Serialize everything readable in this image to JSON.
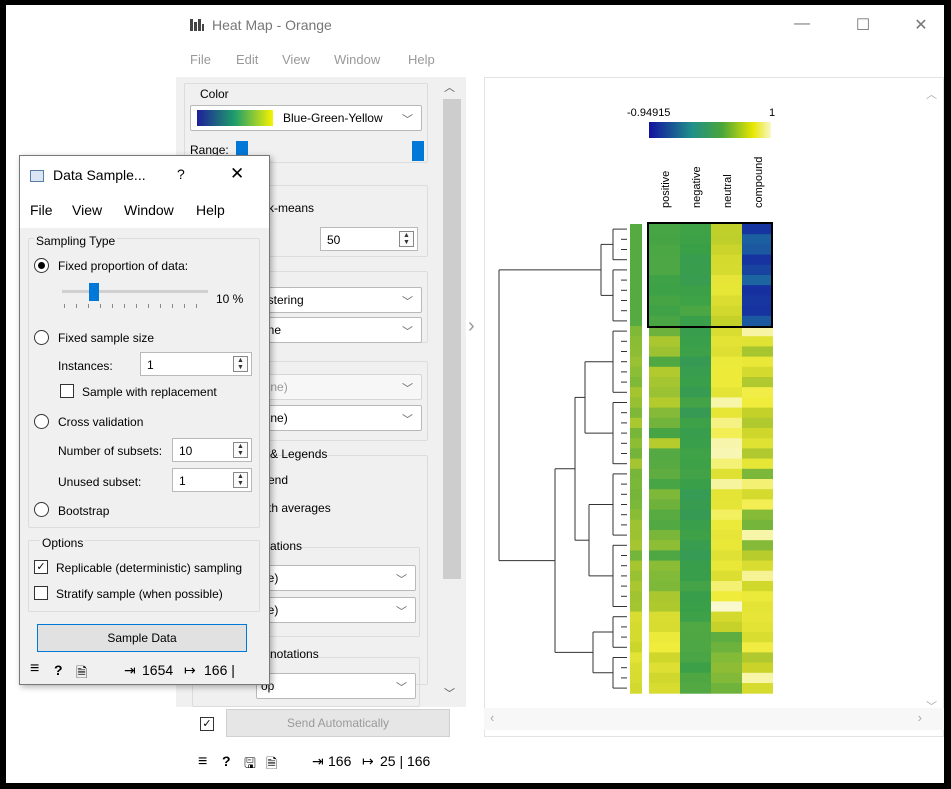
{
  "heatmap_window": {
    "title": "Heat Map - Orange",
    "menu": [
      "File",
      "Edit",
      "View",
      "Window",
      "Help"
    ],
    "controls": {
      "color_group_label": "Color",
      "palette_name": "Blue-Green-Yellow",
      "range_label": "Range:",
      "kmeans_partial": "k-means",
      "kmeans_value": "50",
      "clustering_partial": "ustering",
      "none_partial_1": "one",
      "none_partial_2": "lone)",
      "none_partial_3": "lone)",
      "legends_partial": "& Legends",
      "legend_partial": "end",
      "averages_partial": "th averages",
      "annotations_partial": "ations",
      "none_partial_4": "ne)",
      "none_partial_5": "ne)",
      "col_annotations_partial": "notations",
      "position_partial": "op"
    },
    "send_automatically_checked": true,
    "send_label": "Send Automatically",
    "status": {
      "input": "166",
      "output": "25 | 166"
    },
    "plot": {
      "legend_min": "-0.94915",
      "legend_max": "1",
      "columns": [
        "positive",
        "negative",
        "neutral",
        "compound"
      ]
    }
  },
  "sampler_window": {
    "title": "Data Sample...",
    "help": "?",
    "close": "✕",
    "menu": [
      "File",
      "View",
      "Window",
      "Help"
    ],
    "sampling_type_label": "Sampling Type",
    "fixed_proportion_label": "Fixed proportion of data:",
    "proportion_value": "10 %",
    "proportion_fraction": 0.1,
    "fixed_size_label": "Fixed sample size",
    "instances_label": "Instances:",
    "instances_value": "1",
    "replacement_label": "Sample with replacement",
    "cross_validation_label": "Cross validation",
    "subsets_label": "Number of subsets:",
    "subsets_value": "10",
    "unused_label": "Unused subset:",
    "unused_value": "1",
    "bootstrap_label": "Bootstrap",
    "options_label": "Options",
    "replicable_label": "Replicable (deterministic) sampling",
    "replicable_checked": true,
    "stratify_label": "Stratify sample (when possible)",
    "stratify_checked": false,
    "sample_button": "Sample Data",
    "status": {
      "input": "1654",
      "output": "166 |"
    }
  },
  "colors": {
    "accent": "#0078d7",
    "palette_low": "#1a1aa8",
    "palette_mid": "#3a9a4a",
    "palette_high": "#f7f7a0"
  }
}
